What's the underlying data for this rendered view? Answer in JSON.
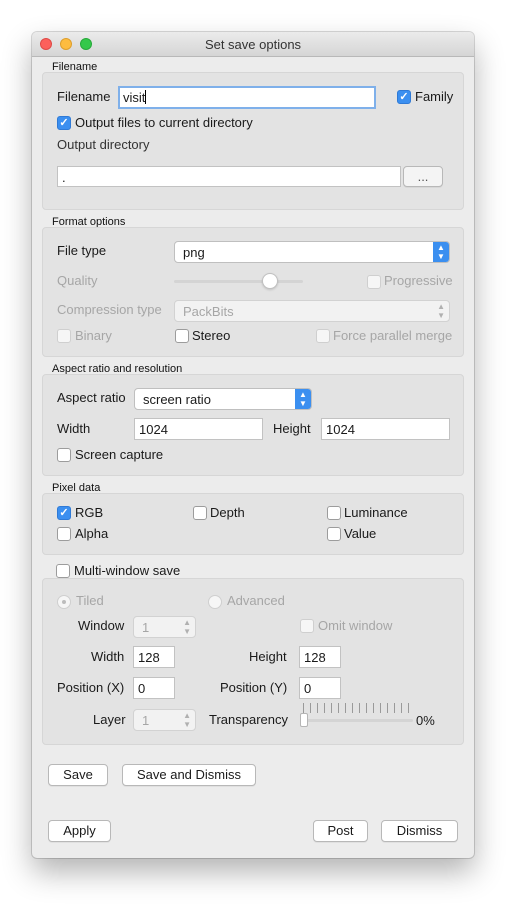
{
  "window": {
    "title": "Set save options"
  },
  "filename_group": {
    "title": "Filename",
    "filename_label": "Filename",
    "filename_value": "visit",
    "family_label": "Family",
    "family_checked": true,
    "output_current_label": "Output files to current directory",
    "output_current_checked": true,
    "output_dir_label": "Output directory",
    "output_dir_value": ".",
    "browse_label": "..."
  },
  "format_group": {
    "title": "Format options",
    "file_type_label": "File type",
    "file_type_value": "png",
    "quality_label": "Quality",
    "quality_level": 0.75,
    "progressive_label": "Progressive",
    "compression_label": "Compression type",
    "compression_value": "PackBits",
    "binary_label": "Binary",
    "stereo_label": "Stereo",
    "force_parallel_label": "Force parallel merge"
  },
  "aspect_group": {
    "title": "Aspect ratio and resolution",
    "aspect_label": "Aspect ratio",
    "aspect_value": "screen ratio",
    "width_label": "Width",
    "width_value": "1024",
    "height_label": "Height",
    "height_value": "1024",
    "screen_capture_label": "Screen capture"
  },
  "pixel_group": {
    "title": "Pixel data",
    "rgb_label": "RGB",
    "rgb_checked": true,
    "depth_label": "Depth",
    "luminance_label": "Luminance",
    "alpha_label": "Alpha",
    "value_label": "Value"
  },
  "multi_window": {
    "label": "Multi-window save",
    "tiled_label": "Tiled",
    "advanced_label": "Advanced",
    "window_label": "Window",
    "window_value": "1",
    "omit_window_label": "Omit window",
    "width_label": "Width",
    "width_value": "128",
    "height_label": "Height",
    "height_value": "128",
    "pos_x_label": "Position (X)",
    "pos_x_value": "0",
    "pos_y_label": "Position (Y)",
    "pos_y_value": "0",
    "layer_label": "Layer",
    "layer_value": "1",
    "transparency_label": "Transparency",
    "transparency_value": "0%"
  },
  "buttons": {
    "save": "Save",
    "save_dismiss": "Save and Dismiss",
    "apply": "Apply",
    "post": "Post",
    "dismiss": "Dismiss"
  },
  "colors": {
    "accent": "#3b8ff0",
    "close": "#fc605c",
    "minimize": "#fdbc40",
    "zoom": "#34c84a"
  }
}
